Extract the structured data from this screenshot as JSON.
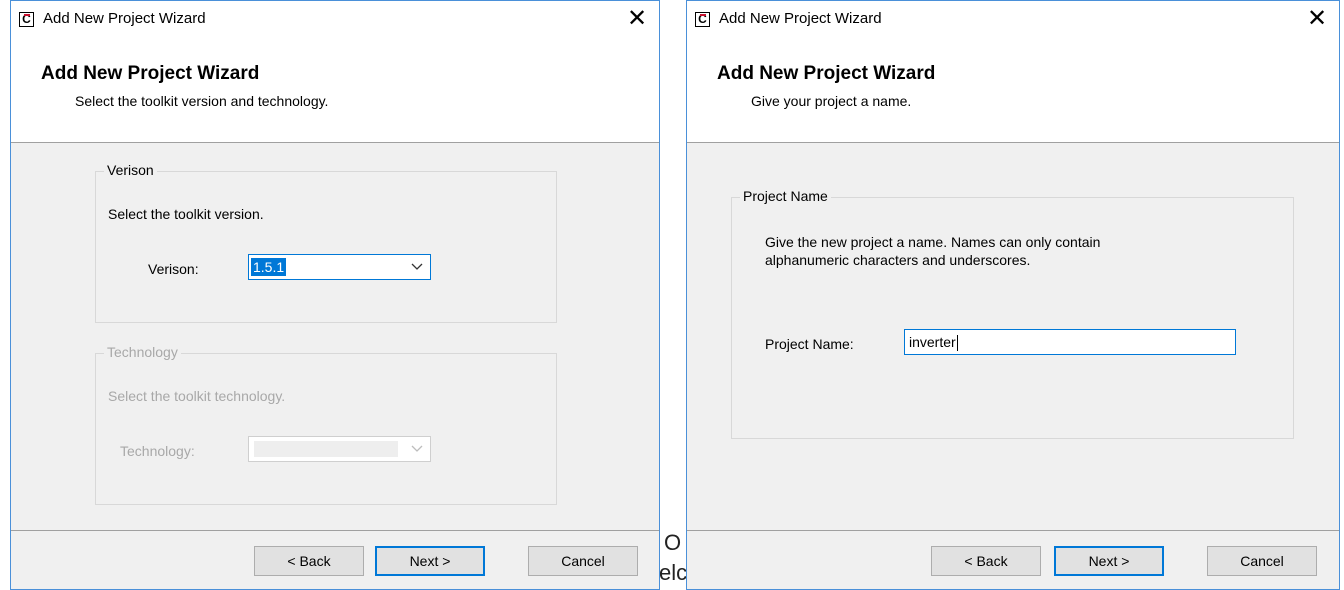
{
  "background_fragments": {
    "fragment_o": "O",
    "fragment_elc": "elc"
  },
  "left_dialog": {
    "title": "Add New Project Wizard",
    "close_glyph": "✕",
    "header_title": "Add New Project Wizard",
    "header_subtitle": "Select the toolkit version and technology.",
    "version_group": {
      "legend": "Verison",
      "description": "Select the toolkit version.",
      "label": "Verison:",
      "selected_value": "1.5.1"
    },
    "technology_group": {
      "legend": "Technology",
      "description": "Select the toolkit technology.",
      "label": "Technology:",
      "selected_value": ""
    },
    "buttons": {
      "back": "< Back",
      "next": "Next >",
      "cancel": "Cancel"
    }
  },
  "right_dialog": {
    "title": "Add New Project Wizard",
    "close_glyph": "✕",
    "header_title": "Add New Project Wizard",
    "header_subtitle": "Give your project a name.",
    "project_group": {
      "legend": "Project Name",
      "description_line1": "Give the new project a name. Names can only contain",
      "description_line2": "alphanumeric characters and underscores.",
      "label": "Project Name:",
      "value": "inverter"
    },
    "buttons": {
      "back": "< Back",
      "next": "Next >",
      "cancel": "Cancel"
    }
  },
  "icons": {
    "app": "app-logo-icon",
    "close": "close-icon",
    "dropdown": "chevron-down-icon"
  },
  "colors": {
    "accent": "#0078d7",
    "border": "#4a90d9",
    "disabled_text": "#a8a8a8"
  }
}
